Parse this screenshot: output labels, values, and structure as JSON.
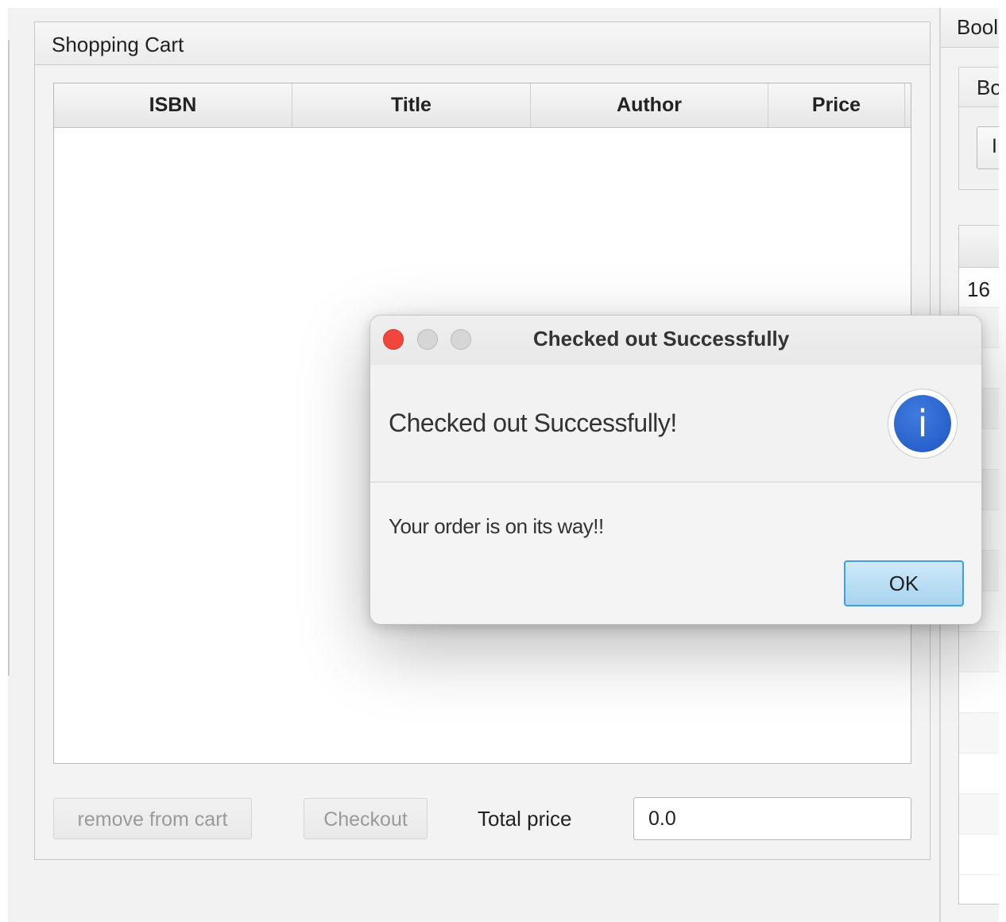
{
  "cart": {
    "title": "Shopping Cart",
    "columns": [
      "ISBN",
      "Title",
      "Author",
      "Price"
    ],
    "remove_label": "remove from cart",
    "checkout_label": "Checkout",
    "total_label": "Total price",
    "total_value": "0.0"
  },
  "right_panel": {
    "header": "Bool",
    "sub_header": "Bo",
    "field_text": "I",
    "first_cell": "16"
  },
  "dialog": {
    "title": "Checked out Successfully",
    "header_text": "Checked out Successfully!",
    "body_text": "Your order is on its way!!",
    "ok_label": "OK",
    "icon": "info-icon"
  },
  "colors": {
    "close_button": "#f2453c",
    "ok_border": "#3d9ee0",
    "info_blue": "#1f56c2"
  }
}
